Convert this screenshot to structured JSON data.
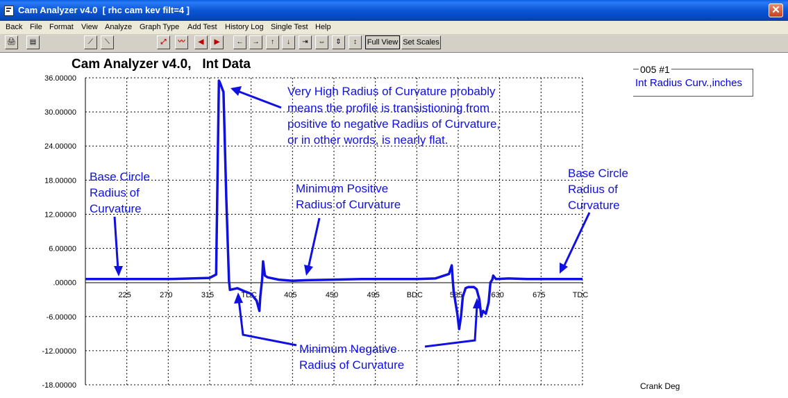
{
  "window": {
    "title": "Cam Analyzer v4.0  [ rhc cam kev filt=4 ]",
    "close_label": "✕"
  },
  "menu": [
    "Back",
    "File",
    "Format",
    "View",
    "Analyze",
    "Graph Type",
    "Add Test",
    "History Log",
    "Single Test",
    "Help"
  ],
  "toolbar": {
    "full_view": "Full View",
    "set_scales": "Set Scales"
  },
  "chart_title": "Cam Analyzer v4.0,   Int Data",
  "legend": {
    "id": "005 #1",
    "label": "Int Radius Curv.,inches"
  },
  "annotations": {
    "flat": [
      "Very High Radius of Curvature probably",
      "means the profile is transistioning from",
      "positive to negative Radius of Curvature,",
      "or in other words, is nearly flat."
    ],
    "base_left": [
      "Base Circle",
      "Radius of",
      "Curvature"
    ],
    "min_pos": [
      "Minimum Positive",
      "Radius of Curvature"
    ],
    "base_right": [
      "Base Circle",
      "Radius of",
      "Curvature"
    ],
    "min_neg": [
      "Minimum Negative",
      "Radius of Curvature"
    ]
  },
  "colors": {
    "line": "#1010e0",
    "annotation": "#1010e0"
  },
  "chart_data": {
    "type": "line",
    "title": "Cam Analyzer v4.0,   Int Data",
    "xlabel": "Crank Deg",
    "ylabel": "",
    "xlim": [
      180,
      720
    ],
    "ylim": [
      -18,
      36
    ],
    "x_ticks": [
      225,
      270,
      315,
      360,
      405,
      450,
      495,
      540,
      585,
      630,
      675,
      720
    ],
    "x_tick_labels": [
      "225",
      "270",
      "315",
      "TDC",
      "405",
      "450",
      "495",
      "BDC",
      "585",
      "630",
      "675",
      "TDC"
    ],
    "y_ticks": [
      36,
      30,
      24,
      18,
      12,
      6,
      0,
      -6,
      -12,
      -18
    ],
    "y_tick_labels": [
      "36.00000",
      "30.00000",
      "24.00000",
      "18.00000",
      "12.00000",
      "6.00000",
      ".00000",
      "-6.00000",
      "-12.00000",
      "-18.00000"
    ],
    "grid": true,
    "series": [
      {
        "name": "Int Radius Curv.,inches",
        "x": [
          180,
          210,
          240,
          270,
          295,
          315,
          322,
          325,
          326,
          330,
          333,
          336,
          337,
          345,
          352,
          360,
          366,
          369,
          370,
          372,
          373,
          375,
          378,
          390,
          405,
          420,
          450,
          480,
          510,
          540,
          560,
          575,
          578,
          579,
          580,
          582,
          584,
          586,
          588,
          590,
          593,
          596,
          602,
          605,
          608,
          610,
          612,
          615,
          618,
          620,
          622,
          623,
          624,
          626,
          640,
          660,
          690,
          720
        ],
        "y": [
          0.6,
          0.6,
          0.6,
          0.6,
          0.7,
          0.8,
          1.4,
          35.5,
          35.2,
          33.5,
          15.0,
          0.3,
          -1.3,
          -1.0,
          -1.5,
          -2.0,
          -3.2,
          -5.0,
          -2.5,
          0.6,
          3.7,
          1.2,
          0.9,
          0.5,
          0.3,
          0.4,
          0.5,
          0.6,
          0.6,
          0.6,
          0.7,
          1.5,
          3.0,
          0.6,
          -1.5,
          -3.5,
          -5.5,
          -8.2,
          -6.0,
          -2.5,
          -1.0,
          -0.8,
          -0.8,
          -1.2,
          -3.0,
          -6.0,
          -5.0,
          -5.5,
          -3.5,
          0.0,
          0.5,
          1.2,
          1.0,
          0.6,
          0.7,
          0.6,
          0.6,
          0.6
        ]
      }
    ]
  }
}
